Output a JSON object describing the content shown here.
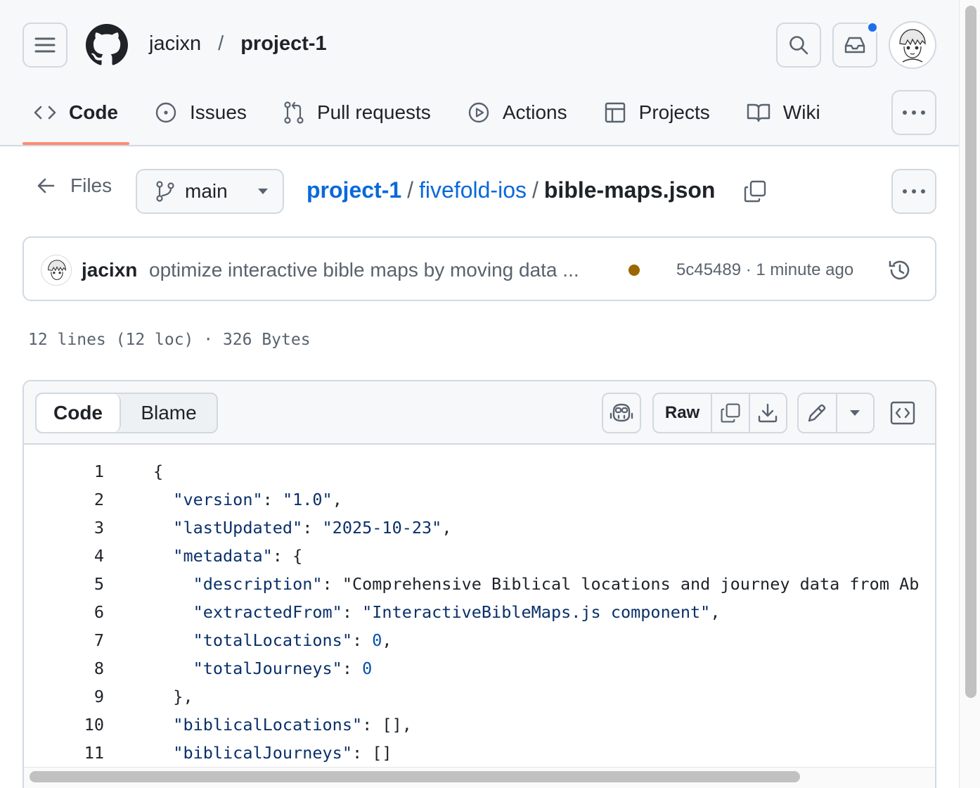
{
  "header": {
    "owner": "jacixn",
    "separator": "/",
    "repo": "project-1"
  },
  "tabs": [
    {
      "label": "Code",
      "icon": "code-icon",
      "active": true
    },
    {
      "label": "Issues",
      "icon": "issue-icon",
      "active": false
    },
    {
      "label": "Pull requests",
      "icon": "pull-request-icon",
      "active": false
    },
    {
      "label": "Actions",
      "icon": "play-icon",
      "active": false
    },
    {
      "label": "Projects",
      "icon": "table-icon",
      "active": false
    },
    {
      "label": "Wiki",
      "icon": "book-icon",
      "active": false
    }
  ],
  "file_nav": {
    "back_label": "Files",
    "branch": "main",
    "breadcrumb": [
      "project-1",
      "fivefold-ios"
    ],
    "breadcrumb_sep": "/",
    "file_name": "bible-maps.json"
  },
  "commit": {
    "author": "jacixn",
    "message": "optimize interactive bible maps by moving data ...",
    "status_color": "#9a6700",
    "meta": "5c45489 · 1 minute ago"
  },
  "file_info": "12 lines (12 loc) · 326 Bytes",
  "viewer": {
    "code_tab": "Code",
    "blame_tab": "Blame",
    "raw_label": "Raw"
  },
  "code_lines": [
    {
      "n": "1",
      "text": "{"
    },
    {
      "n": "2",
      "text": "  \"version\": \"1.0\","
    },
    {
      "n": "3",
      "text": "  \"lastUpdated\": \"2025-10-23\","
    },
    {
      "n": "4",
      "text": "  \"metadata\": {"
    },
    {
      "n": "5",
      "text": "    \"description\": \"Comprehensive Biblical locations and journey data from Ab"
    },
    {
      "n": "6",
      "text": "    \"extractedFrom\": \"InteractiveBibleMaps.js component\","
    },
    {
      "n": "7",
      "text": "    \"totalLocations\": 0,"
    },
    {
      "n": "8",
      "text": "    \"totalJourneys\": 0"
    },
    {
      "n": "9",
      "text": "  },"
    },
    {
      "n": "10",
      "text": "  \"biblicalLocations\": [],"
    },
    {
      "n": "11",
      "text": "  \"biblicalJourneys\": []"
    }
  ],
  "colors": {
    "accent_link": "#0969da",
    "active_tab_underline": "#fd8c73",
    "notification_dot": "#1f6feb"
  }
}
